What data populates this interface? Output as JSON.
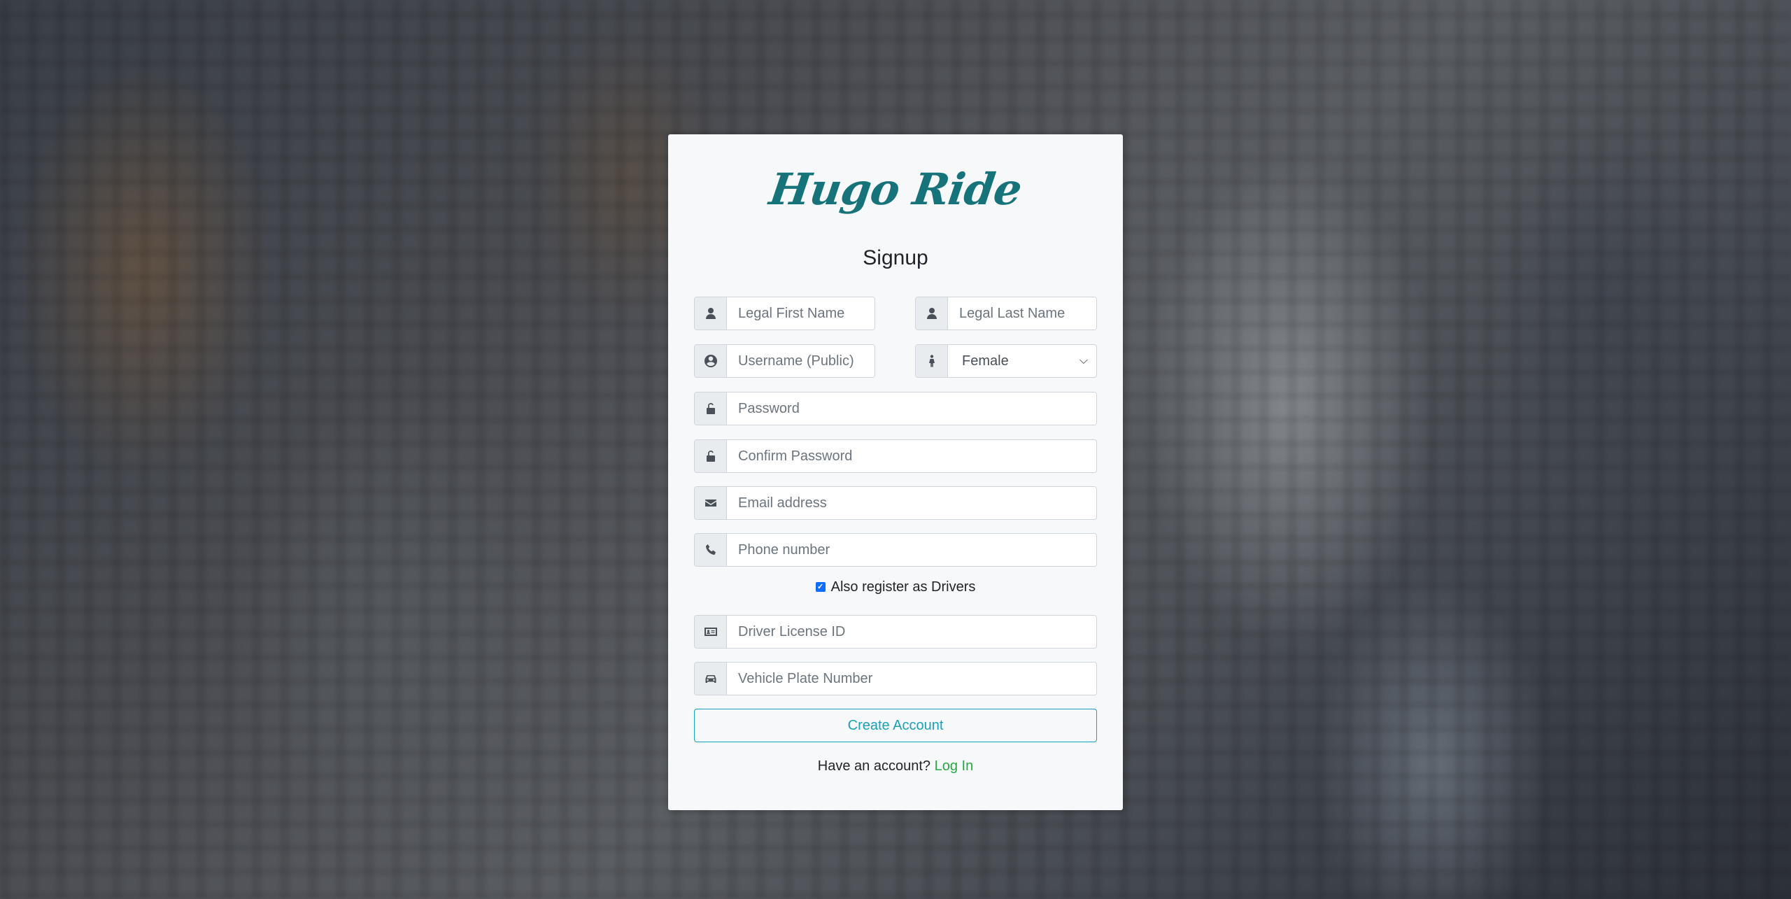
{
  "brand": {
    "logo_text": "Hugo Ride"
  },
  "form": {
    "title": "Signup",
    "first_name_placeholder": "Legal First Name",
    "last_name_placeholder": "Legal Last Name",
    "username_placeholder": "Username (Public)",
    "gender_selected": "Female",
    "password_placeholder": "Password",
    "confirm_password_placeholder": "Confirm Password",
    "email_placeholder": "Email address",
    "phone_placeholder": "Phone number",
    "driver_checkbox_label": "Also register as Drivers",
    "driver_checkbox_checked": true,
    "license_placeholder": "Driver License ID",
    "plate_placeholder": "Vehicle Plate Number",
    "submit_label": "Create Account",
    "login_prompt": "Have an account?",
    "login_link": "Log In"
  },
  "icons": {
    "first_name": "user-icon",
    "last_name": "user-icon",
    "username": "user-circle-icon",
    "gender": "female-icon",
    "password": "unlock-icon",
    "confirm_password": "unlock-icon",
    "email": "envelope-icon",
    "phone": "phone-icon",
    "license": "id-card-icon",
    "plate": "car-icon"
  },
  "colors": {
    "brand": "#17737a",
    "button_outline": "#17a2b8",
    "link": "#28a745",
    "checkbox": "#0d6efd"
  }
}
